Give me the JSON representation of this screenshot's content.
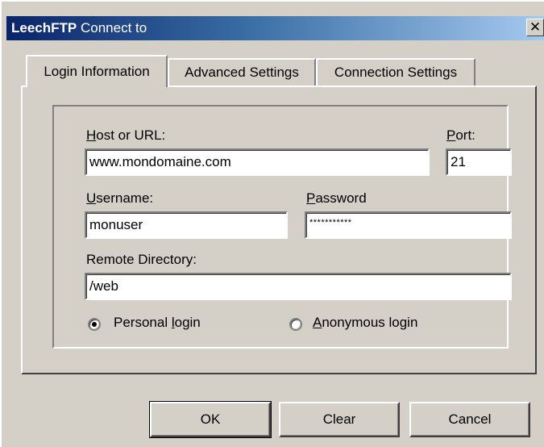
{
  "window": {
    "title_app": "LeechFTP",
    "title_rest": " Connect to",
    "close_glyph": "✕"
  },
  "tabs": [
    {
      "label": "Login Information",
      "active": true
    },
    {
      "label": "Advanced Settings",
      "active": false
    },
    {
      "label": "Connection Settings",
      "active": false
    }
  ],
  "form": {
    "host_label_u": "H",
    "host_label_rest": "ost or URL:",
    "host_value": "www.mondomaine.com",
    "port_label_u": "P",
    "port_label_rest": "ort:",
    "port_value": "21",
    "username_label_u": "U",
    "username_label_rest": "sername:",
    "username_value": "monuser",
    "password_label_u": "P",
    "password_label_rest": "assword",
    "password_value": "***********",
    "remote_dir_label": "Remote Directory:",
    "remote_dir_value": "/web",
    "personal_login_pre": "Personal ",
    "personal_login_u": "l",
    "personal_login_post": "ogin",
    "personal_login_checked": true,
    "anonymous_login_u": "A",
    "anonymous_login_rest": "nonymous login",
    "anonymous_login_checked": false
  },
  "buttons": {
    "ok": "OK",
    "clear": "Clear",
    "cancel": "Cancel"
  },
  "colors": {
    "title_gradient_start": "#0a246a",
    "title_gradient_end": "#a6caf0",
    "face": "#d4d0c8"
  },
  "icons": {
    "close": "close-icon",
    "radio_selected": "radio-selected-icon",
    "radio_unselected": "radio-unselected-icon"
  }
}
